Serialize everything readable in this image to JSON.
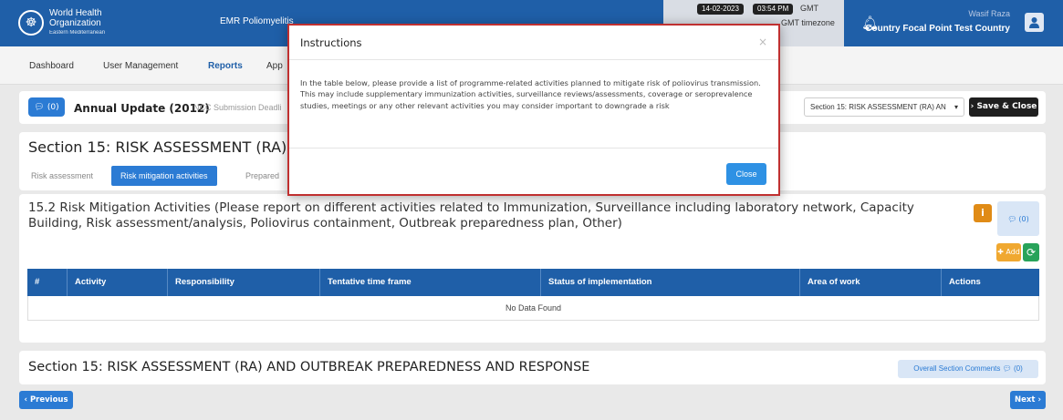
{
  "header": {
    "logo_line1": "World Health",
    "logo_line2": "Organization",
    "logo_line3": "Eastern Mediterranean",
    "app_title": "EMR Poliomyelitis",
    "date": "14-02-2023",
    "time": "03:54 PM",
    "gmt": "GMT",
    "timezone": "GMT timezone",
    "user_name": "Wasif Raza",
    "user_role": "Country Focal Point Test Country"
  },
  "nav": {
    "items": [
      "Dashboard",
      "User Management",
      "Reports",
      "App"
    ],
    "active_index": 2
  },
  "toolbar": {
    "comment_count": "(0)",
    "annual_update": "Annual Update (2012)",
    "deadline": "NCC Submission Deadli",
    "section_select": "Section 15: RISK ASSESSMENT (RA) AN",
    "save_close": "Save & Close"
  },
  "section": {
    "title": "Section 15: RISK ASSESSMENT (RA) AN",
    "tabs": [
      "Risk assessment",
      "Risk mitigation activities",
      "Prepared"
    ],
    "active_tab": 1
  },
  "mitigation": {
    "title": "15.2 Risk Mitigation Activities (Please report on different activities related to Immunization, Surveillance including laboratory network, Capacity Building, Risk assessment/analysis, Poliovirus containment, Outbreak preparedness plan, Other)",
    "info_glyph": "i",
    "comment_count": "(0)",
    "add_label": "Add",
    "columns": [
      "#",
      "Activity",
      "Responsibility",
      "Tentative time frame",
      "Status of implementation",
      "Area of work",
      "Actions"
    ],
    "empty_text": "No Data Found"
  },
  "footer": {
    "title": "Section 15: RISK ASSESSMENT (RA) AND OUTBREAK PREPAREDNESS AND RESPONSE",
    "overall_comments": "Overall Section Comments",
    "overall_count": "(0)",
    "previous": "Previous",
    "next": "Next"
  },
  "modal": {
    "title": "Instructions",
    "close_x": "×",
    "body": "In the table below, please provide a list of programme-related activities planned to mitigate risk of poliovirus transmission. This may include supplementary immunization activities, surveillance reviews/assessments, coverage or seroprevalence studies, meetings or any other relevant activities you may consider important to downgrade a risk",
    "close_button": "Close"
  },
  "colors": {
    "header_blue": "#1f5fa8",
    "accent_blue": "#2b7bd4",
    "modal_border": "#c03030",
    "orange": "#e08b16",
    "green": "#28a35a"
  }
}
